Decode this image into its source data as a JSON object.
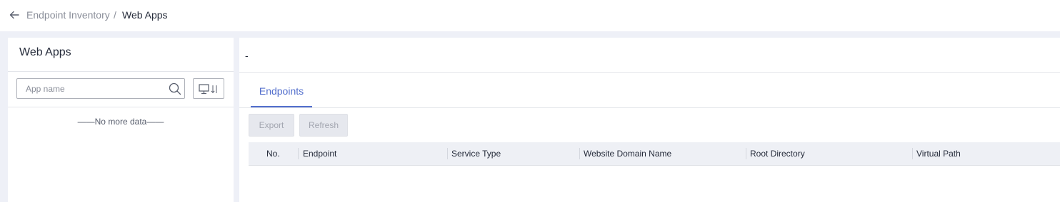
{
  "breadcrumb": {
    "parent": "Endpoint Inventory",
    "separator": "/",
    "current": "Web Apps"
  },
  "left_panel": {
    "title": "Web Apps",
    "search_placeholder": "App name",
    "empty_text": "——No more data——"
  },
  "right_panel": {
    "detail_title": "-",
    "tabs": [
      {
        "label": "Endpoints",
        "active": true
      }
    ],
    "buttons": {
      "export": "Export",
      "refresh": "Refresh"
    },
    "table": {
      "columns": [
        "No.",
        "Endpoint",
        "Service Type",
        "Website Domain Name",
        "Root Directory",
        "Virtual Path"
      ],
      "rows": []
    }
  },
  "icons": {
    "back": "arrow-left-icon",
    "search": "search-icon",
    "os_filter": "monitor-sort-icon"
  },
  "colors": {
    "accent": "#526ecc",
    "page_bg": "#eef0f7",
    "table_header_bg": "#eef0f5",
    "disabled_button_bg": "#e6e8ee"
  }
}
